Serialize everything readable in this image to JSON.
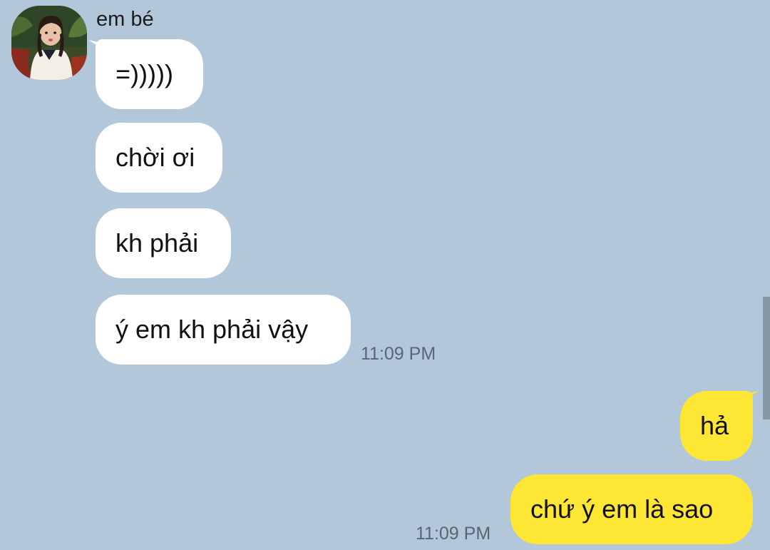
{
  "conversation": {
    "incoming": {
      "sender_name": "em bé",
      "avatar_icon": "profile-photo",
      "messages": [
        {
          "text": "=)))))"
        },
        {
          "text": "chời ơi"
        },
        {
          "text": "kh phải"
        },
        {
          "text": "ý em kh phải vậy"
        }
      ],
      "timestamp": "11:09 PM"
    },
    "outgoing": {
      "messages": [
        {
          "text": "hả"
        },
        {
          "text": "chứ ý em là sao"
        }
      ],
      "timestamp": "11:09 PM"
    }
  },
  "colors": {
    "background": "#b2c7d9",
    "incoming_bubble": "#ffffff",
    "outgoing_bubble": "#fee634",
    "timestamp": "#5a6670"
  }
}
